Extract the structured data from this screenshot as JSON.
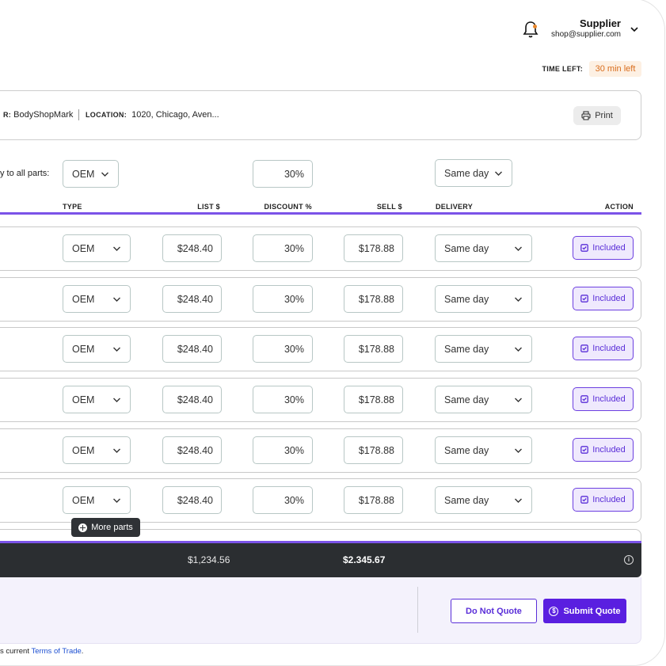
{
  "header": {
    "user_name": "Supplier",
    "user_email": "shop@supplier.com",
    "time_left_label": "TIME LEFT:",
    "time_left_value": "30 min left"
  },
  "info": {
    "buyer_label_fragment": "R:",
    "buyer_value": "BodyShopMark",
    "location_label": "LOCATION:",
    "location_value": "1020, Chicago, Aven...",
    "print_label": "Print"
  },
  "apply_all": {
    "label": "y to all parts:",
    "type": "OEM",
    "discount": "30%",
    "delivery": "Same day"
  },
  "columns": {
    "type": "TYPE",
    "list": "LIST $",
    "discount": "DISCOUNT %",
    "sell": "SELL $",
    "delivery": "DELIVERY",
    "action": "ACTION"
  },
  "rows": [
    {
      "type": "OEM",
      "list": "$248.40",
      "discount": "30%",
      "sell": "$178.88",
      "delivery": "Same day",
      "action": "Included"
    },
    {
      "type": "OEM",
      "list": "$248.40",
      "discount": "30%",
      "sell": "$178.88",
      "delivery": "Same day",
      "action": "Included"
    },
    {
      "type": "OEM",
      "list": "$248.40",
      "discount": "30%",
      "sell": "$178.88",
      "delivery": "Same day",
      "action": "Included"
    },
    {
      "type": "OEM",
      "list": "$248.40",
      "discount": "30%",
      "sell": "$178.88",
      "delivery": "Same day",
      "action": "Included"
    },
    {
      "type": "OEM",
      "list": "$248.40",
      "discount": "30%",
      "sell": "$178.88",
      "delivery": "Same day",
      "action": "Included"
    },
    {
      "type": "OEM",
      "list": "$248.40",
      "discount": "30%",
      "sell": "$178.88",
      "delivery": "Same day",
      "action": "Included"
    }
  ],
  "more_parts_label": "More parts",
  "totals": {
    "list_total": "$1,234.56",
    "sell_total": "$2.345.67"
  },
  "footer": {
    "do_not_quote": "Do Not Quote",
    "submit_quote": "Submit Quote",
    "terms_prefix": "s current ",
    "terms_link": "Terms of Trade",
    "terms_suffix": "."
  },
  "colors": {
    "accent": "#5a1fe0",
    "accent_line": "#7b53e8",
    "time_badge_bg": "#fdf0e3",
    "time_badge_text": "#d96c1c",
    "total_bar": "#2b2e31"
  },
  "icons": {
    "bell": "bell-icon",
    "chevron": "chevron-down-icon",
    "printer": "printer-icon",
    "check_box": "check-square-icon",
    "plus_circle": "plus-circle-icon",
    "info": "info-icon",
    "dollar_circle": "dollar-circle-icon"
  }
}
